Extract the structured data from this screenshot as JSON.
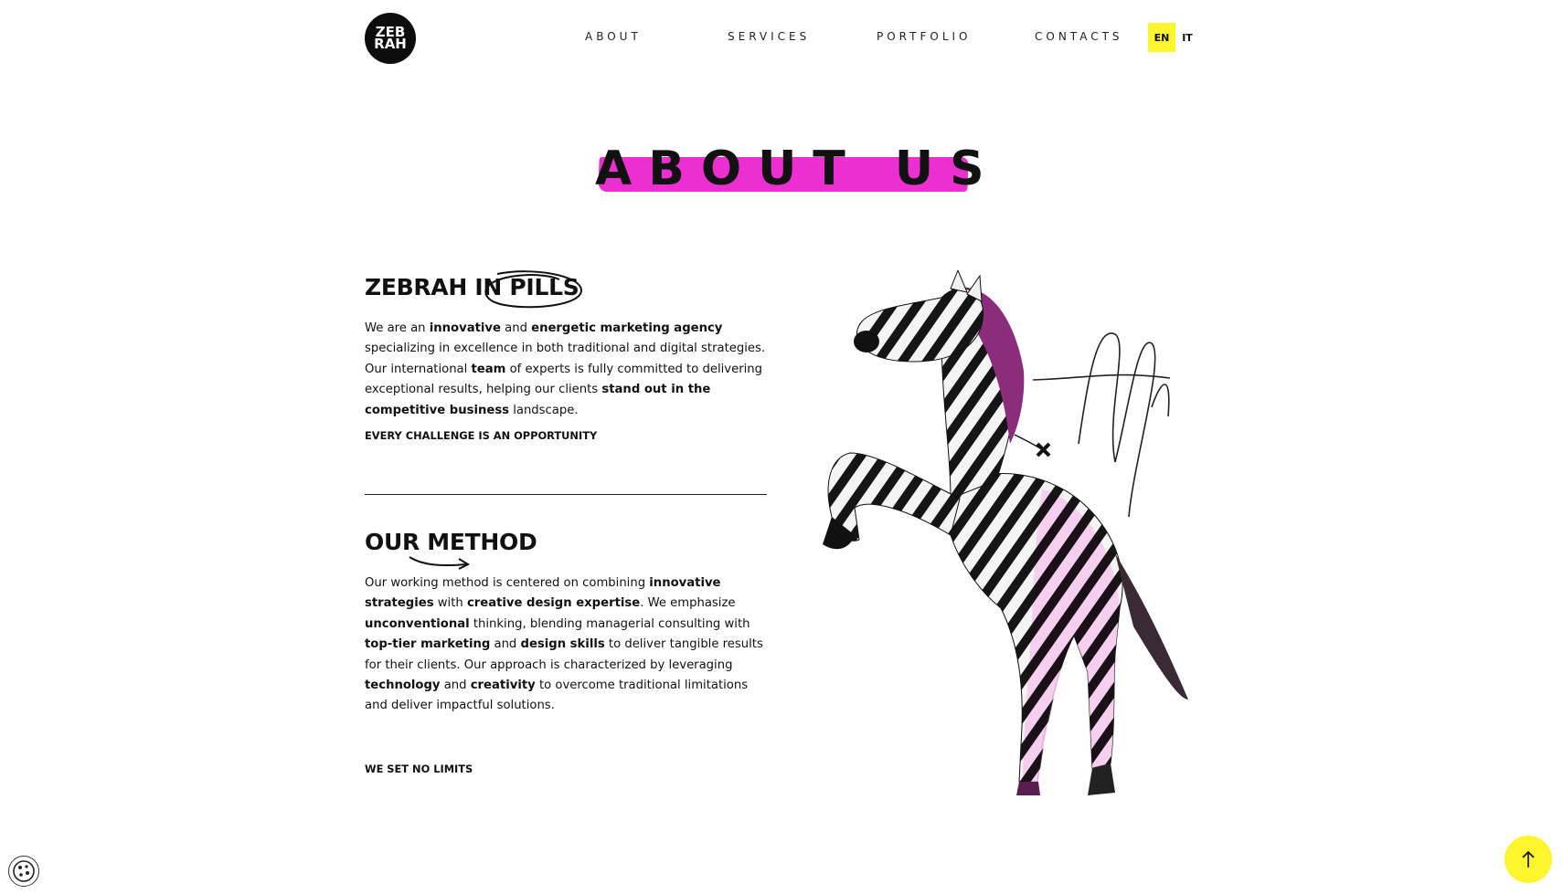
{
  "header": {
    "logo_top": "ZEB",
    "logo_bottom": "RAH",
    "nav": [
      {
        "label": "ABOUT"
      },
      {
        "label": "SERVICES"
      },
      {
        "label": "PORTFOLIO"
      },
      {
        "label": "CONTACTS"
      }
    ],
    "languages": [
      {
        "label": "EN",
        "active": true
      },
      {
        "label": "IT",
        "active": false
      }
    ]
  },
  "page_title": "ABOUT US",
  "sections": [
    {
      "title": "ZEBRAH IN PILLS",
      "paragraph": [
        {
          "t": "We are an ",
          "b": false
        },
        {
          "t": "innovative",
          "b": true
        },
        {
          "t": " and ",
          "b": false
        },
        {
          "t": "energetic marketing agency",
          "b": true
        },
        {
          "t": " specializing in excellence in both traditional and digital strategies. Our international ",
          "b": false
        },
        {
          "t": "team",
          "b": true
        },
        {
          "t": " of experts is fully committed to delivering exceptional results, helping our clients ",
          "b": false
        },
        {
          "t": "stand out in the competitive business",
          "b": true
        },
        {
          "t": " landscape.",
          "b": false
        }
      ],
      "tagline": "EVERY CHALLENGE IS AN OPPORTUNITY"
    },
    {
      "title": "OUR METHOD",
      "paragraph": [
        {
          "t": "Our working method is centered on combining ",
          "b": false
        },
        {
          "t": "innovative strategies",
          "b": true
        },
        {
          "t": " with ",
          "b": false
        },
        {
          "t": "creative design expertise",
          "b": true
        },
        {
          "t": ". We emphasize ",
          "b": false
        },
        {
          "t": "unconventional",
          "b": true
        },
        {
          "t": " thinking, blending managerial consulting with ",
          "b": false
        },
        {
          "t": "top-tier marketing",
          "b": true
        },
        {
          "t": " and ",
          "b": false
        },
        {
          "t": "design skills",
          "b": true
        },
        {
          "t": " to deliver tangible results for their clients. Our approach is characterized by leveraging ",
          "b": false
        },
        {
          "t": "technology",
          "b": true
        },
        {
          "t": " and ",
          "b": false
        },
        {
          "t": "creativity",
          "b": true
        },
        {
          "t": " to overcome traditional limitations and deliver impactful solutions.",
          "b": false
        }
      ],
      "tagline": "WE SET NO LIMITS"
    }
  ],
  "colors": {
    "accent_magenta": "#ec2fd1",
    "accent_yellow": "#fdf52e",
    "text": "#111111"
  },
  "icons": {
    "cookie": "cookie-icon",
    "back_to_top": "arrow-up-icon",
    "zebra": "zebra-illustration"
  }
}
